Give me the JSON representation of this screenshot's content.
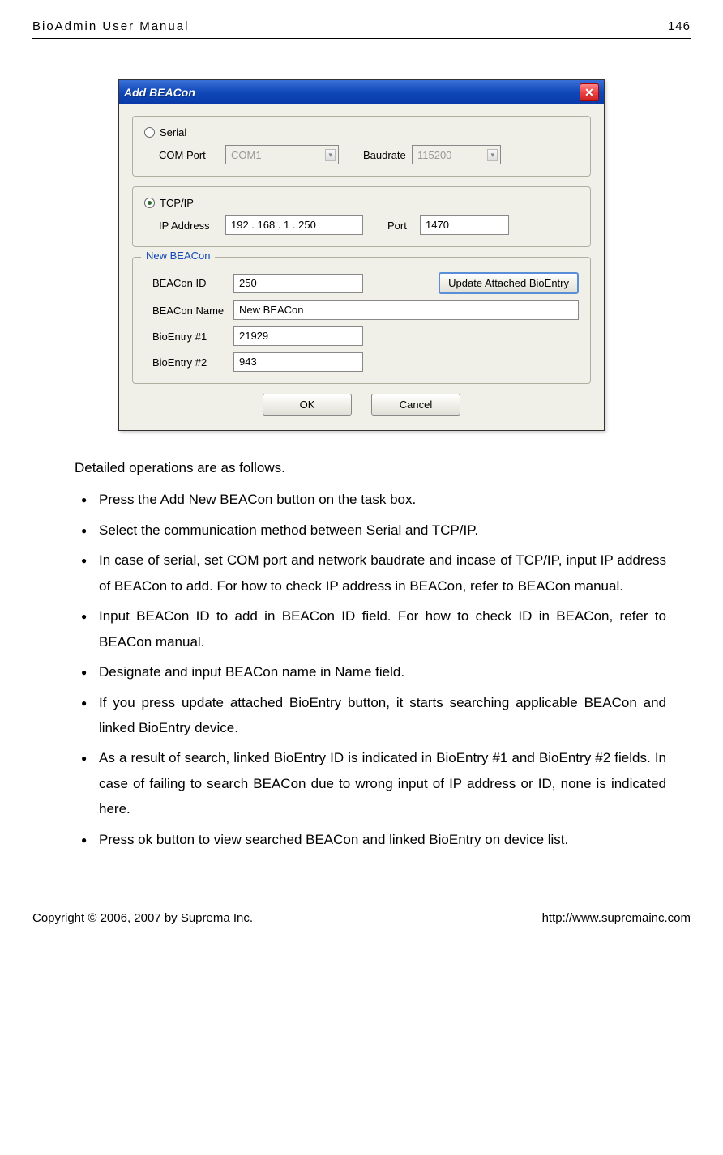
{
  "header": {
    "title": "BioAdmin User Manual",
    "page": "146"
  },
  "dialog": {
    "title": "Add BEACon",
    "serial": {
      "radio_label": "Serial",
      "checked": false,
      "com_label": "COM Port",
      "com_value": "COM1",
      "baud_label": "Baudrate",
      "baud_value": "115200"
    },
    "tcpip": {
      "radio_label": "TCP/IP",
      "checked": true,
      "ip_label": "IP Address",
      "ip_value": "192 . 168 .   1   . 250",
      "port_label": "Port",
      "port_value": "1470"
    },
    "newbeacon": {
      "group_title": "New BEACon",
      "id_label": "BEACon ID",
      "id_value": "250",
      "update_btn": "Update Attached BioEntry",
      "name_label": "BEACon Name",
      "name_value": "New BEACon",
      "bio1_label": "BioEntry #1",
      "bio1_value": "21929",
      "bio2_label": "BioEntry #2",
      "bio2_value": "943"
    },
    "ok": "OK",
    "cancel": "Cancel"
  },
  "body": {
    "intro": "Detailed operations are as follows.",
    "bullets": [
      "Press the Add New BEACon button on the task box.",
      "Select the communication method between Serial and TCP/IP.",
      "In case of serial, set COM port and network baudrate and incase of TCP/IP, input IP address of BEACon to add. For how to check IP address in BEACon, refer to BEACon manual.",
      "Input BEACon ID to add in BEACon ID field. For how to check ID in BEACon, refer to BEACon manual.",
      "Designate and input BEACon name in Name field.",
      "If you press update attached BioEntry button, it starts searching applicable BEACon and linked BioEntry device.",
      "As a result of search, linked BioEntry ID is indicated in BioEntry #1 and BioEntry #2 fields. In case of failing to search BEACon due to wrong input of IP address or ID, none is indicated here.",
      "Press ok button to view searched BEACon and linked BioEntry on device list."
    ]
  },
  "footer": {
    "copyright": "Copyright © 2006, 2007 by Suprema Inc.",
    "url": "http://www.supremainc.com"
  }
}
